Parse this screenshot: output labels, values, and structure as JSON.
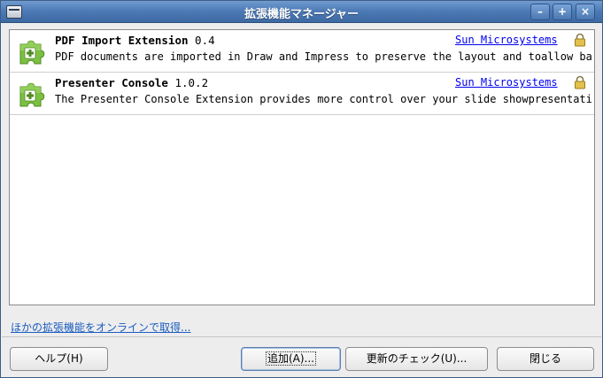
{
  "window": {
    "title": "拡張機能マネージャー",
    "controls": {
      "minimize": "–",
      "maximize": "+",
      "close": "×"
    }
  },
  "extensions": [
    {
      "name": "PDF Import Extension",
      "version": "0.4",
      "publisher": "Sun Microsystems",
      "description": "PDF documents are imported in Draw and Impress to preserve the layout and toallow ba..."
    },
    {
      "name": "Presenter Console",
      "version": "1.0.2",
      "publisher": "Sun Microsystems",
      "description": "The Presenter Console Extension provides more control over your slide showpresentati..."
    }
  ],
  "links": {
    "get_more_online": "ほかの拡張機能をオンラインで取得..."
  },
  "buttons": {
    "help": "ヘルプ(H)",
    "add": "追加(A)...",
    "check_updates": "更新のチェック(U)...",
    "close": "閉じる"
  },
  "colors": {
    "titlebar": "#4b79b4",
    "link": "#0000ee",
    "puzzle_green": "#7cc043"
  }
}
